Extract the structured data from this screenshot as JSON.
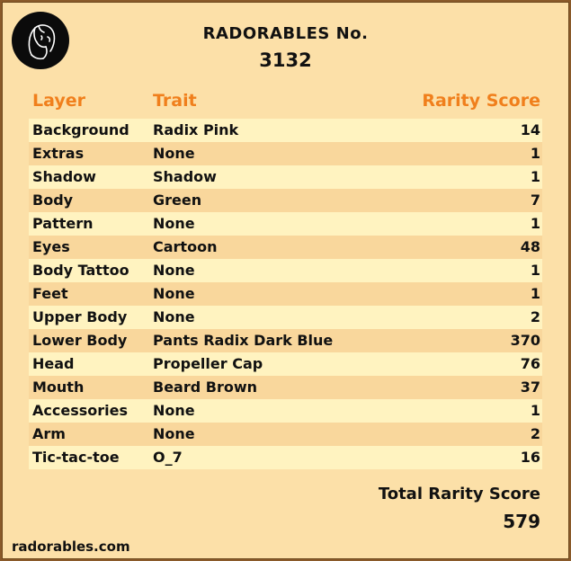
{
  "logo": {
    "icon": "radorables-face-logo"
  },
  "header": {
    "title": "RADORABLES No.",
    "number": "3132"
  },
  "table": {
    "columns": {
      "layer": "Layer",
      "trait": "Trait",
      "score": "Rarity Score"
    },
    "rows": [
      {
        "layer": "Background",
        "trait": "Radix Pink",
        "score": "14"
      },
      {
        "layer": "Extras",
        "trait": "None",
        "score": "1"
      },
      {
        "layer": "Shadow",
        "trait": "Shadow",
        "score": "1"
      },
      {
        "layer": "Body",
        "trait": "Green",
        "score": "7"
      },
      {
        "layer": "Pattern",
        "trait": "None",
        "score": "1"
      },
      {
        "layer": "Eyes",
        "trait": "Cartoon",
        "score": "48"
      },
      {
        "layer": "Body Tattoo",
        "trait": "None",
        "score": "1"
      },
      {
        "layer": "Feet",
        "trait": "None",
        "score": "1"
      },
      {
        "layer": "Upper Body",
        "trait": "None",
        "score": "2"
      },
      {
        "layer": "Lower Body",
        "trait": "Pants Radix Dark Blue",
        "score": "370"
      },
      {
        "layer": "Head",
        "trait": "Propeller Cap",
        "score": "76"
      },
      {
        "layer": "Mouth",
        "trait": "Beard Brown",
        "score": "37"
      },
      {
        "layer": "Accessories",
        "trait": "None",
        "score": "1"
      },
      {
        "layer": "Arm",
        "trait": "None",
        "score": "2"
      },
      {
        "layer": "Tic-tac-toe",
        "trait": "O_7",
        "score": "16"
      }
    ]
  },
  "total": {
    "label": "Total Rarity Score",
    "value": "579"
  },
  "footer": {
    "site": "radorables.com"
  },
  "colors": {
    "background": "#fce0a8",
    "header_accent": "#f07f1c",
    "row_light": "#fff3c0",
    "row_dark": "#f9d79c"
  }
}
